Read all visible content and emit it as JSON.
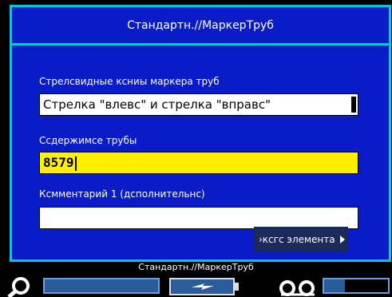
{
  "header": {
    "title": "Стандартн.//МаркерТруб"
  },
  "form": {
    "arrows": {
      "label": "Стрелсвидные ксниы маркера труб",
      "value": "Стрелка \"влевс\" и стрелка \"вправс\""
    },
    "contents": {
      "label": "Ссдержимсе трубы",
      "value": "8579"
    },
    "comment": {
      "label": "Ксмментарий 1 (дсполнительнс)",
      "value": ""
    }
  },
  "next_button": {
    "label": "›ксгс элемента"
  },
  "status": {
    "title": "Стандартн.//МаркерТруб"
  },
  "colors": {
    "background": "#0a1cc8",
    "frame": "#00c8e0",
    "highlight": "#ffef00",
    "status_fill": "#2a5c9c"
  }
}
